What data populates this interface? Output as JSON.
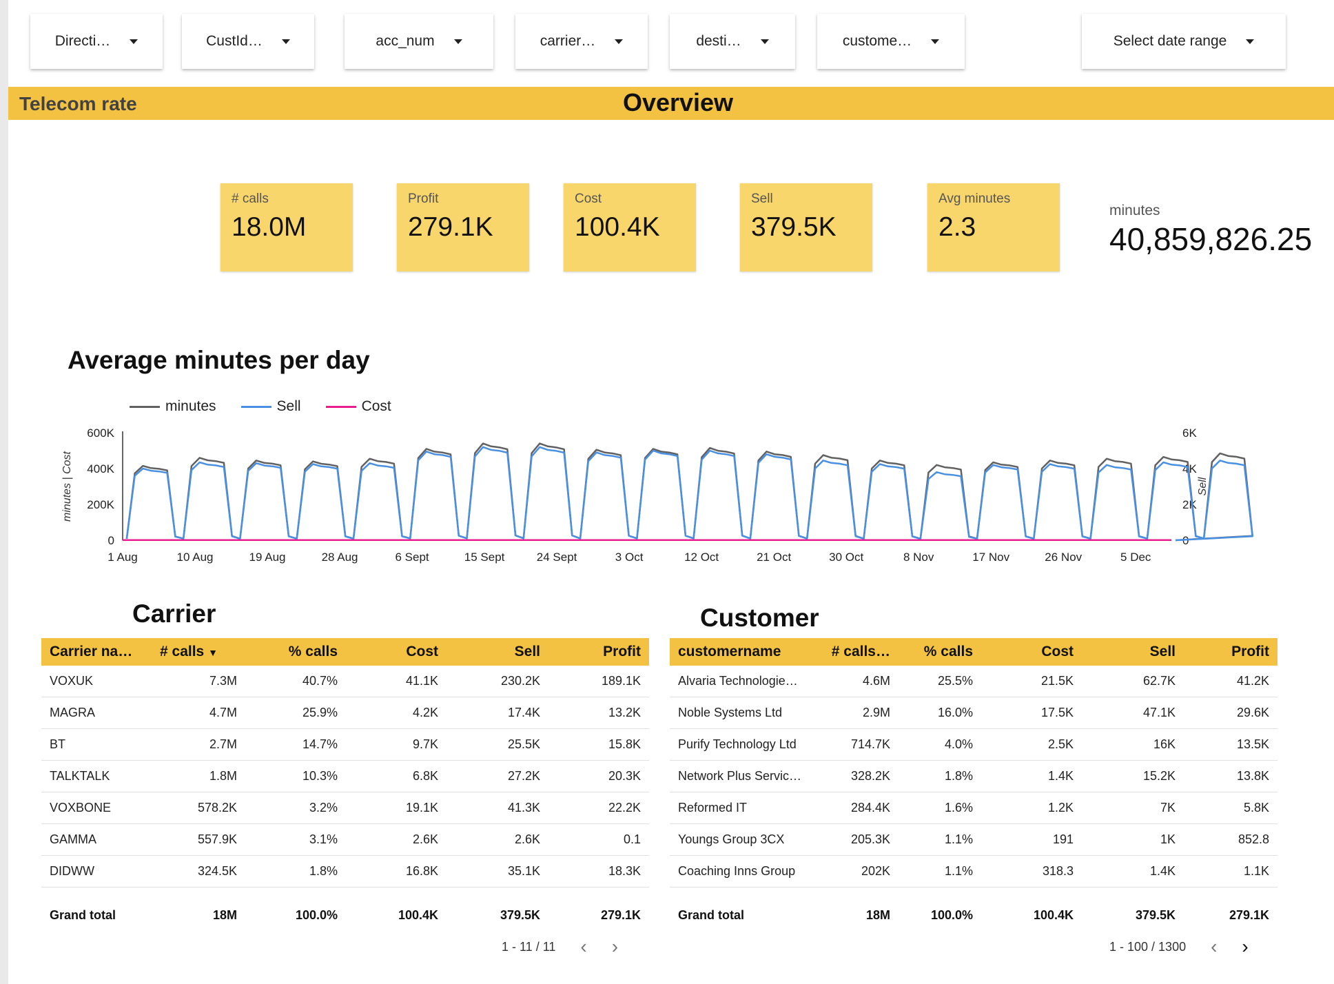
{
  "filters": [
    {
      "label": "Directi…"
    },
    {
      "label": "CustId…"
    },
    {
      "label": "acc_num"
    },
    {
      "label": "carrier…"
    },
    {
      "label": "desti…"
    },
    {
      "label": "custome…"
    },
    {
      "label": "Select date range"
    }
  ],
  "banner": {
    "left_title": "Telecom rate",
    "center_title": "Overview"
  },
  "kpis": [
    {
      "label": "# calls",
      "value": "18.0M"
    },
    {
      "label": "Profit",
      "value": "279.1K"
    },
    {
      "label": "Cost",
      "value": "100.4K"
    },
    {
      "label": "Sell",
      "value": "379.5K"
    },
    {
      "label": "Avg minutes",
      "value": "2.3"
    }
  ],
  "minutes": {
    "label": "minutes",
    "value": "40,859,826.25"
  },
  "chart_title": "Average minutes per day",
  "chart_data": {
    "type": "line",
    "title": "Average minutes per day",
    "ylabel": "minutes | Cost",
    "y2label": "Sell",
    "ylim": [
      0,
      600000
    ],
    "y2lim": [
      0,
      6000
    ],
    "yticks": [
      "600K",
      "400K",
      "200K",
      "0"
    ],
    "y2ticks": [
      "6K",
      "4K",
      "2K",
      "0"
    ],
    "xticks": [
      "1 Aug",
      "10 Aug",
      "19 Aug",
      "28 Aug",
      "6 Sept",
      "15 Sept",
      "24 Sept",
      "3 Oct",
      "12 Oct",
      "21 Oct",
      "30 Oct",
      "8 Nov",
      "17 Nov",
      "26 Nov",
      "5 Dec"
    ],
    "legend_position": "top-left",
    "grid": false,
    "series": [
      {
        "name": "minutes",
        "color": "#616161",
        "axis": "left"
      },
      {
        "name": "Sell",
        "color": "#4a90e2",
        "axis": "right"
      },
      {
        "name": "Cost",
        "color": "#e91e8c",
        "axis": "left"
      }
    ],
    "weeks": [
      {
        "minutes": 415000,
        "sell": 4000
      },
      {
        "minutes": 460000,
        "sell": 4350
      },
      {
        "minutes": 445000,
        "sell": 4300
      },
      {
        "minutes": 440000,
        "sell": 4250
      },
      {
        "minutes": 455000,
        "sell": 4300
      },
      {
        "minutes": 510000,
        "sell": 4950
      },
      {
        "minutes": 540000,
        "sell": 5200
      },
      {
        "minutes": 540000,
        "sell": 5200
      },
      {
        "minutes": 505000,
        "sell": 4900
      },
      {
        "minutes": 510000,
        "sell": 5000
      },
      {
        "minutes": 515000,
        "sell": 5000
      },
      {
        "minutes": 495000,
        "sell": 4800
      },
      {
        "minutes": 475000,
        "sell": 4450
      },
      {
        "minutes": 445000,
        "sell": 4250
      },
      {
        "minutes": 420000,
        "sell": 3800
      },
      {
        "minutes": 435000,
        "sell": 4200
      },
      {
        "minutes": 445000,
        "sell": 4250
      },
      {
        "minutes": 455000,
        "sell": 4200
      },
      {
        "minutes": 465000,
        "sell": 4350
      },
      {
        "minutes": 485000,
        "sell": 4450
      }
    ],
    "cost": 1000
  },
  "carrier": {
    "title": "Carrier",
    "columns": [
      "Carrier na…",
      "# calls",
      "% calls",
      "Cost",
      "Sell",
      "Profit"
    ],
    "sort_indicator": "▼",
    "rows": [
      [
        "VOXUK",
        "7.3M",
        "40.7%",
        "41.1K",
        "230.2K",
        "189.1K"
      ],
      [
        "MAGRA",
        "4.7M",
        "25.9%",
        "4.2K",
        "17.4K",
        "13.2K"
      ],
      [
        "BT",
        "2.7M",
        "14.7%",
        "9.7K",
        "25.5K",
        "15.8K"
      ],
      [
        "TALKTALK",
        "1.8M",
        "10.3%",
        "6.8K",
        "27.2K",
        "20.3K"
      ],
      [
        "VOXBONE",
        "578.2K",
        "3.2%",
        "19.1K",
        "41.3K",
        "22.2K"
      ],
      [
        "GAMMA",
        "557.9K",
        "3.1%",
        "2.6K",
        "2.6K",
        "0.1"
      ],
      [
        "DIDWW",
        "324.5K",
        "1.8%",
        "16.8K",
        "35.1K",
        "18.3K"
      ]
    ],
    "total": [
      "Grand total",
      "18M",
      "100.0%",
      "100.4K",
      "379.5K",
      "279.1K"
    ],
    "pager": "1 - 11 / 11"
  },
  "customer": {
    "title": "Customer",
    "columns": [
      "customername",
      "# calls…",
      "% calls",
      "Cost",
      "Sell",
      "Profit"
    ],
    "rows": [
      [
        "Alvaria Technologie…",
        "4.6M",
        "25.5%",
        "21.5K",
        "62.7K",
        "41.2K"
      ],
      [
        "Noble Systems Ltd",
        "2.9M",
        "16.0%",
        "17.5K",
        "47.1K",
        "29.6K"
      ],
      [
        "Purify Technology Ltd",
        "714.7K",
        "4.0%",
        "2.5K",
        "16K",
        "13.5K"
      ],
      [
        "Network Plus Servic…",
        "328.2K",
        "1.8%",
        "1.4K",
        "15.2K",
        "13.8K"
      ],
      [
        "Reformed IT",
        "284.4K",
        "1.6%",
        "1.2K",
        "7K",
        "5.8K"
      ],
      [
        "Youngs Group 3CX",
        "205.3K",
        "1.1%",
        "191",
        "1K",
        "852.8"
      ],
      [
        "Coaching Inns Group",
        "202K",
        "1.1%",
        "318.3",
        "1.4K",
        "1.1K"
      ]
    ],
    "total": [
      "Grand total",
      "18M",
      "100.0%",
      "100.4K",
      "379.5K",
      "279.1K"
    ],
    "pager": "1 - 100 / 1300"
  },
  "icons": {
    "prev": "chevron-left-icon",
    "next": "chevron-right-icon",
    "dropdown": "caret-down-icon"
  }
}
